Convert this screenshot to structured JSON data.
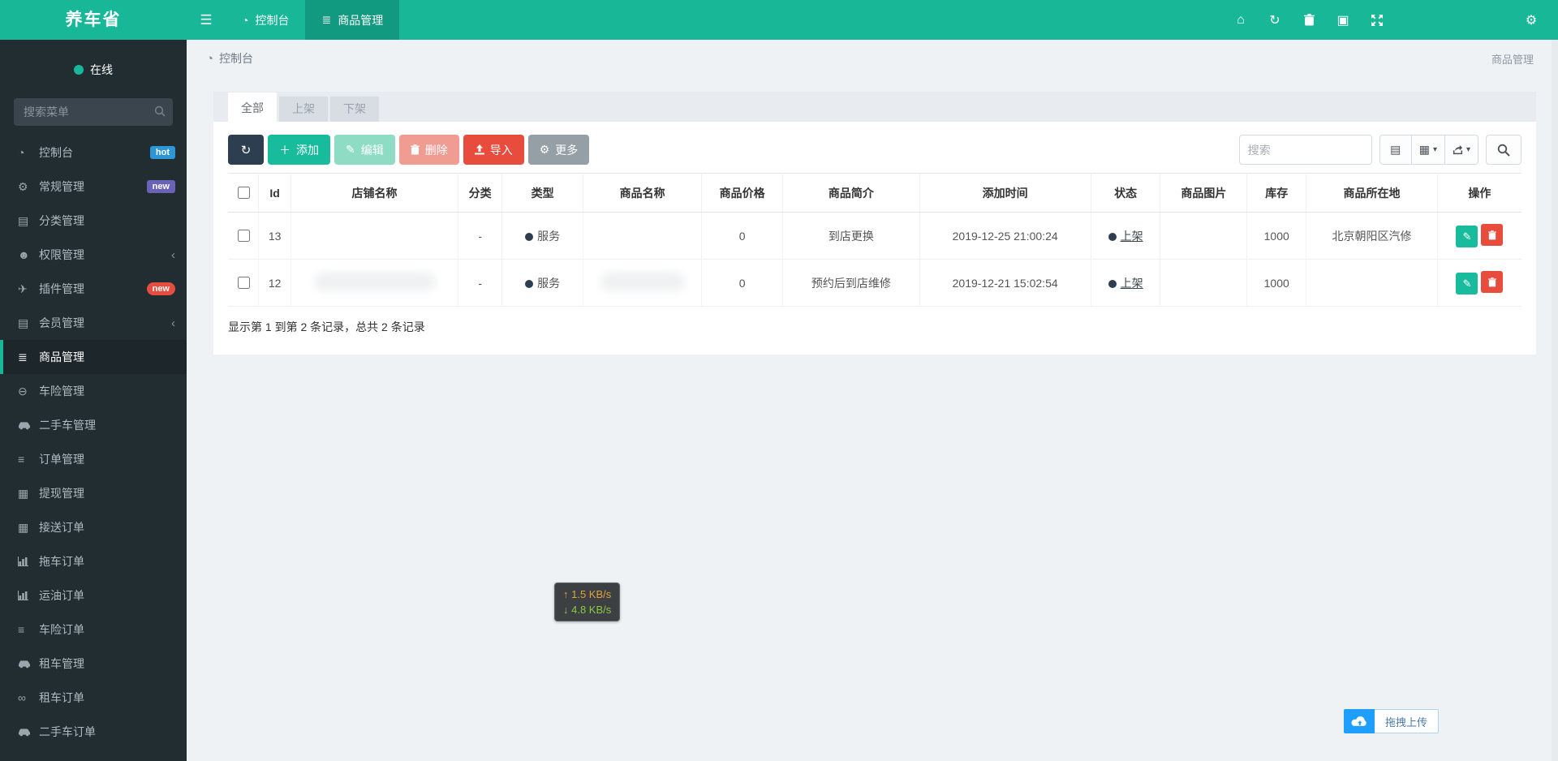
{
  "app": {
    "title": "养车省",
    "online_label": "在线"
  },
  "navbar": {
    "items": [
      {
        "label": "控制台"
      },
      {
        "label": "商品管理"
      }
    ]
  },
  "sidebar": {
    "search_placeholder": "搜索菜单",
    "items": [
      {
        "label": "控制台",
        "badge": "hot"
      },
      {
        "label": "常规管理",
        "badge": "new"
      },
      {
        "label": "分类管理"
      },
      {
        "label": "权限管理"
      },
      {
        "label": "插件管理",
        "badge": "new"
      },
      {
        "label": "会员管理"
      },
      {
        "label": "商品管理"
      },
      {
        "label": "车险管理"
      },
      {
        "label": "二手车管理"
      },
      {
        "label": "订单管理"
      },
      {
        "label": "提现管理"
      },
      {
        "label": "接送订单"
      },
      {
        "label": "拖车订单"
      },
      {
        "label": "运油订单"
      },
      {
        "label": "车险订单"
      },
      {
        "label": "租车管理"
      },
      {
        "label": "租车订单"
      },
      {
        "label": "二手车订单"
      }
    ]
  },
  "breadcrumb": {
    "current": "控制台",
    "page_title": "商品管理"
  },
  "tabs": [
    {
      "label": "全部"
    },
    {
      "label": "上架"
    },
    {
      "label": "下架"
    }
  ],
  "toolbar": {
    "add": "添加",
    "edit": "编辑",
    "remove": "删除",
    "import": "导入",
    "more": "更多",
    "search_placeholder": "搜索"
  },
  "table": {
    "headers": [
      "Id",
      "店铺名称",
      "分类",
      "类型",
      "商品名称",
      "商品价格",
      "商品简介",
      "添加时间",
      "状态",
      "商品图片",
      "库存",
      "商品所在地",
      "操作"
    ],
    "rows": [
      {
        "id": "13",
        "shop": "",
        "category": "-",
        "type": "服务",
        "name": "",
        "price": "0",
        "intro": "到店更换",
        "time": "2019-12-25 21:00:24",
        "status": "上架",
        "image": "",
        "stock": "1000",
        "location": "北京朝阳区汽修"
      },
      {
        "id": "12",
        "shop": "",
        "category": "-",
        "type": "服务",
        "name": "",
        "price": "0",
        "intro": "预约后到店维修",
        "time": "2019-12-21 15:02:54",
        "status": "上架",
        "image": "",
        "stock": "1000",
        "location": ""
      }
    ]
  },
  "summary": "显示第 1 到第 2 条记录，总共 2 条记录",
  "network": {
    "up_arrow": "↑",
    "up": "1.5 KB/s",
    "down_arrow": "↓",
    "down": "4.8 KB/s"
  },
  "upload_button": {
    "label": "拖拽上传"
  },
  "colors": {
    "accent": "#17b798",
    "nav_active": "#129a81",
    "danger": "#e74c3c",
    "dark": "#2c3e50",
    "upload_blue": "#1e9fff",
    "badge_hot": "#2f96d5",
    "badge_new_purple": "#6a62b7",
    "badge_new_red": "#e64c40"
  }
}
